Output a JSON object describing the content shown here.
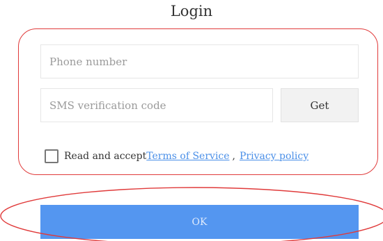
{
  "page": {
    "title": "Login"
  },
  "form": {
    "phone_placeholder": "Phone number",
    "sms_placeholder": "SMS verification code",
    "get_label": "Get",
    "agree_text": "Read and accept",
    "terms_link": "Terms of Service",
    "separator": ",",
    "privacy_link": "Privacy policy",
    "agree_checked": false
  },
  "actions": {
    "ok_label": "OK"
  },
  "colors": {
    "primary": "#5496f0",
    "link": "#4a8fe8",
    "annotation": "#e03a3a",
    "get_button_bg": "#f2f2f2"
  }
}
